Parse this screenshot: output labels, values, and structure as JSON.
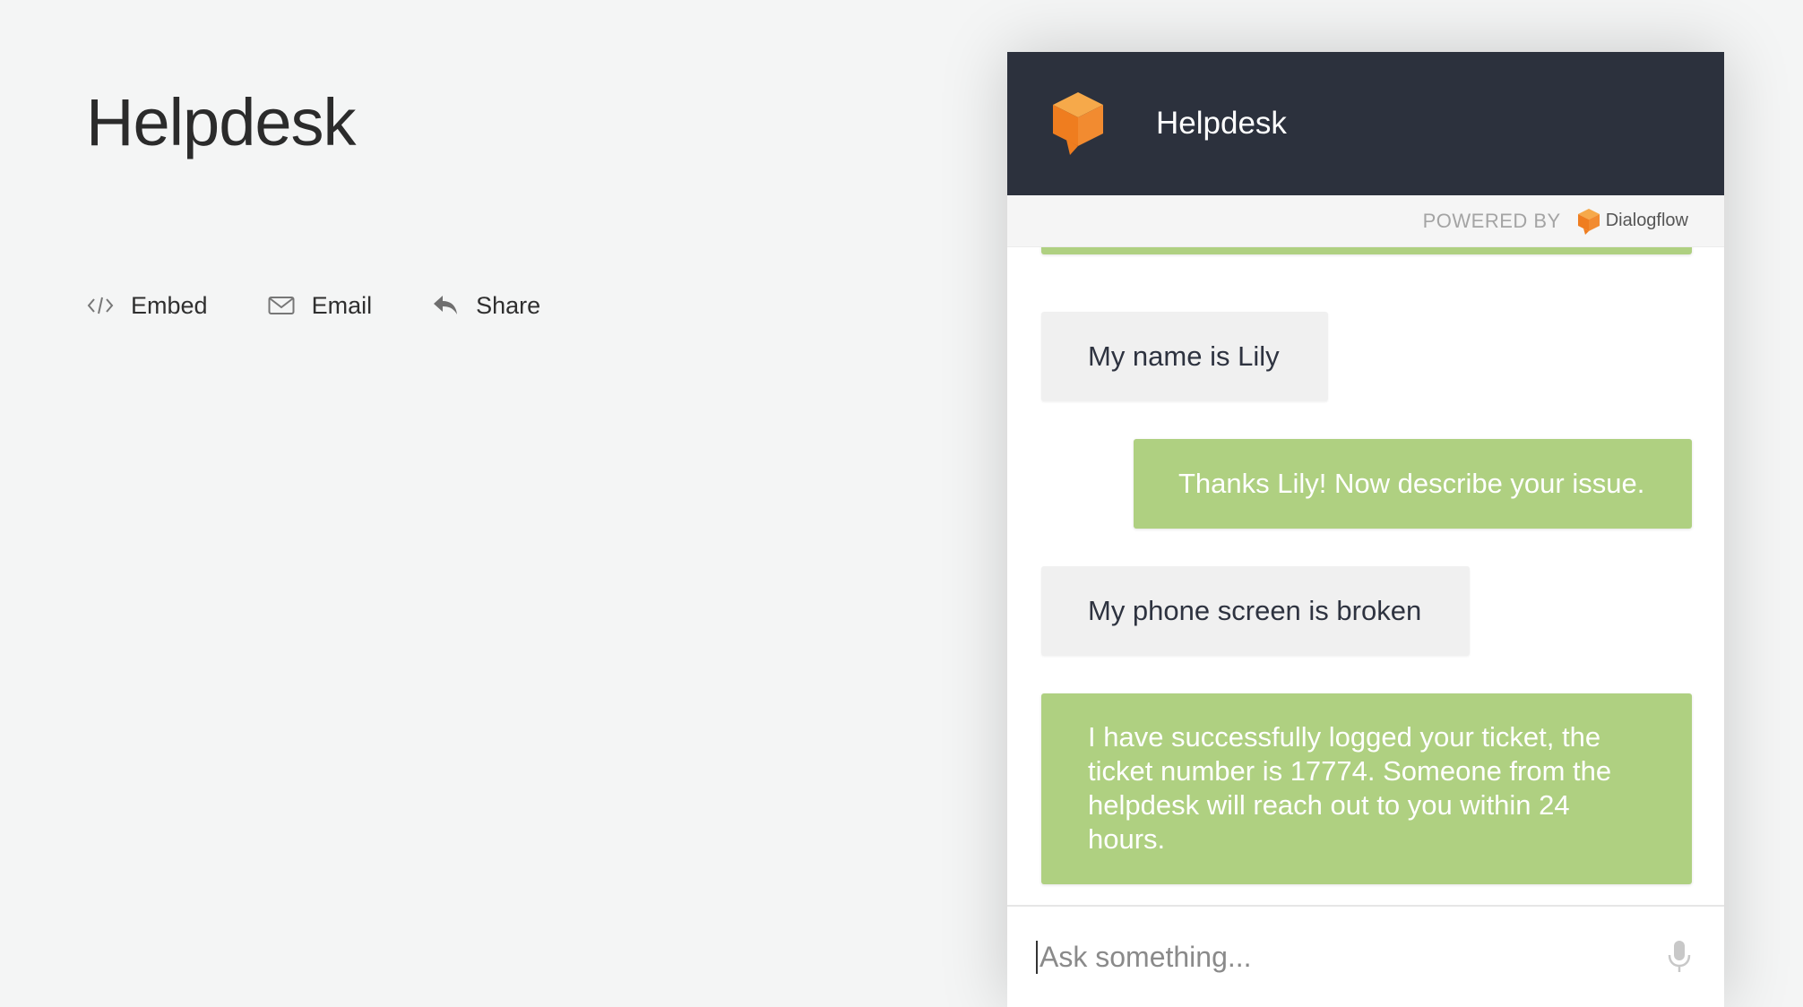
{
  "page": {
    "title": "Helpdesk",
    "actions": [
      {
        "icon": "code-icon",
        "label": "Embed"
      },
      {
        "icon": "mail-icon",
        "label": "Email"
      },
      {
        "icon": "reply-icon",
        "label": "Share"
      }
    ]
  },
  "widget": {
    "title": "Helpdesk",
    "powered_by": "POWERED BY",
    "brand": "Dialogflow",
    "colors": {
      "header_bg": "#2c313d",
      "bot_bubble": "#afd081",
      "user_bubble": "#f0f0f0",
      "logo_orange": "#f28b30"
    },
    "messages": [
      {
        "from": "user",
        "text": "My name is Lily"
      },
      {
        "from": "bot",
        "text": "Thanks Lily! Now describe your issue."
      },
      {
        "from": "user",
        "text": "My phone screen is broken"
      },
      {
        "from": "bot",
        "text": "I have successfully logged your ticket, the ticket number is 17774. Someone from the helpdesk will reach out to you within 24 hours."
      }
    ],
    "input": {
      "placeholder": "Ask something...",
      "value": ""
    }
  }
}
